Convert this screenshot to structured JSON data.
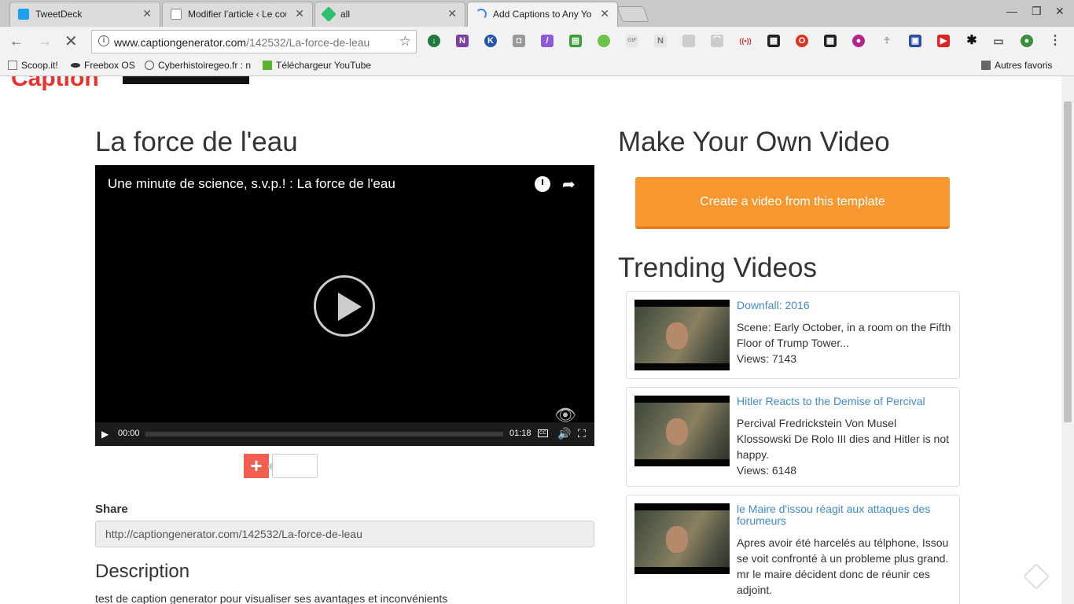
{
  "tabs": [
    {
      "title": "TweetDeck",
      "color": "#1da1f2",
      "active": false
    },
    {
      "title": "Modifier l’article ‹ Le cou",
      "color": "#8a8a8a",
      "active": false
    },
    {
      "title": "all",
      "color": "#2fbf71",
      "active": false
    },
    {
      "title": "Add Captions to Any Yo",
      "color": "#4285f4",
      "active": true
    }
  ],
  "omnibox": {
    "domain": "www.captiongenerator.com",
    "path": "/142532/La-force-de-leau"
  },
  "bookmarks": [
    {
      "label": "Scoop.it!"
    },
    {
      "label": "Freebox OS"
    },
    {
      "label": "Cyberhistoiregeo.fr : n"
    },
    {
      "label": "Téléchargeur YouTube"
    }
  ],
  "bookmarks_other": "Autres favoris",
  "logo": {
    "text": "Caption"
  },
  "video": {
    "page_title": "La force de l'eau",
    "player_title": "Une minute de science, s.v.p.! : La force de l'eau",
    "time_current": "00:00",
    "time_total": "01:18",
    "cc_label": "CC"
  },
  "share": {
    "label": "Share",
    "url": "http://captiongenerator.com/142532/La-force-de-leau"
  },
  "description": {
    "title": "Description",
    "text": "test de caption generator pour visualiser ses avantages et inconvénients"
  },
  "make": {
    "title": "Make Your Own Video",
    "button": "Create a video from this template"
  },
  "trending": {
    "title": "Trending Videos",
    "items": [
      {
        "title": "Downfall: 2016",
        "desc": "Scene: Early October, in a room on the Fifth Floor of Trump Tower...",
        "views": "Views: 7143"
      },
      {
        "title": "Hitler Reacts to the Demise of Percival",
        "desc": "Percival Fredrickstein Von Musel Klossowski De Rolo III dies and Hitler is not happy.",
        "views": "Views: 6148"
      },
      {
        "title": "le Maire d'issou réagit aux attaques des forumeurs",
        "desc": "Apres avoir été harcelés au télphone, Issou se voit confronté à un probleme plus grand. mr le maire décident donc de réunir ces adjoint.",
        "views": ""
      }
    ]
  },
  "colors": {
    "accent_orange": "#f7972f",
    "link_blue": "#428bca",
    "plus_red": "#f05f4f",
    "logo_red": "#e8322f"
  }
}
